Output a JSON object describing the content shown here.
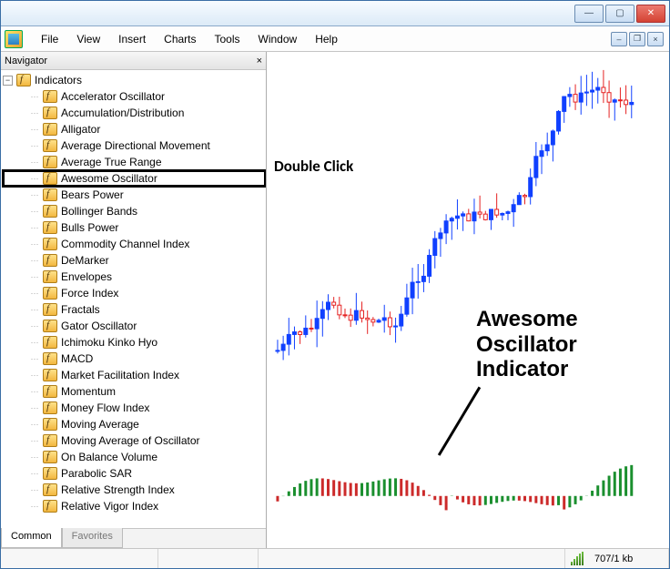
{
  "window": {
    "title": ""
  },
  "menu": {
    "file": "File",
    "view": "View",
    "insert": "Insert",
    "charts": "Charts",
    "tools": "Tools",
    "window": "Window",
    "help": "Help"
  },
  "navigator": {
    "title": "Navigator",
    "root": "Indicators",
    "items": [
      "Accelerator Oscillator",
      "Accumulation/Distribution",
      "Alligator",
      "Average Directional Movement",
      "Average True Range",
      "Awesome Oscillator",
      "Bears Power",
      "Bollinger Bands",
      "Bulls Power",
      "Commodity Channel Index",
      "DeMarker",
      "Envelopes",
      "Force Index",
      "Fractals",
      "Gator Oscillator",
      "Ichimoku Kinko Hyo",
      "MACD",
      "Market Facilitation Index",
      "Momentum",
      "Money Flow Index",
      "Moving Average",
      "Moving Average of Oscillator",
      "On Balance Volume",
      "Parabolic SAR",
      "Relative Strength Index",
      "Relative Vigor Index"
    ],
    "selected_index": 5,
    "tabs": {
      "common": "Common",
      "favorites": "Favorites"
    }
  },
  "annotations": {
    "double_click": "Double Click",
    "ao_label_l1": "Awesome",
    "ao_label_l2": "Oscillator",
    "ao_label_l3": "Indicator"
  },
  "status": {
    "kb": "707/1 kb"
  },
  "chart_data": {
    "type": "candlestick+histogram",
    "note": "Values are approximate pixel-derived estimates; no axes/ticks visible in screenshot",
    "candles_count": 64,
    "oscillator_bars_count": 64
  }
}
